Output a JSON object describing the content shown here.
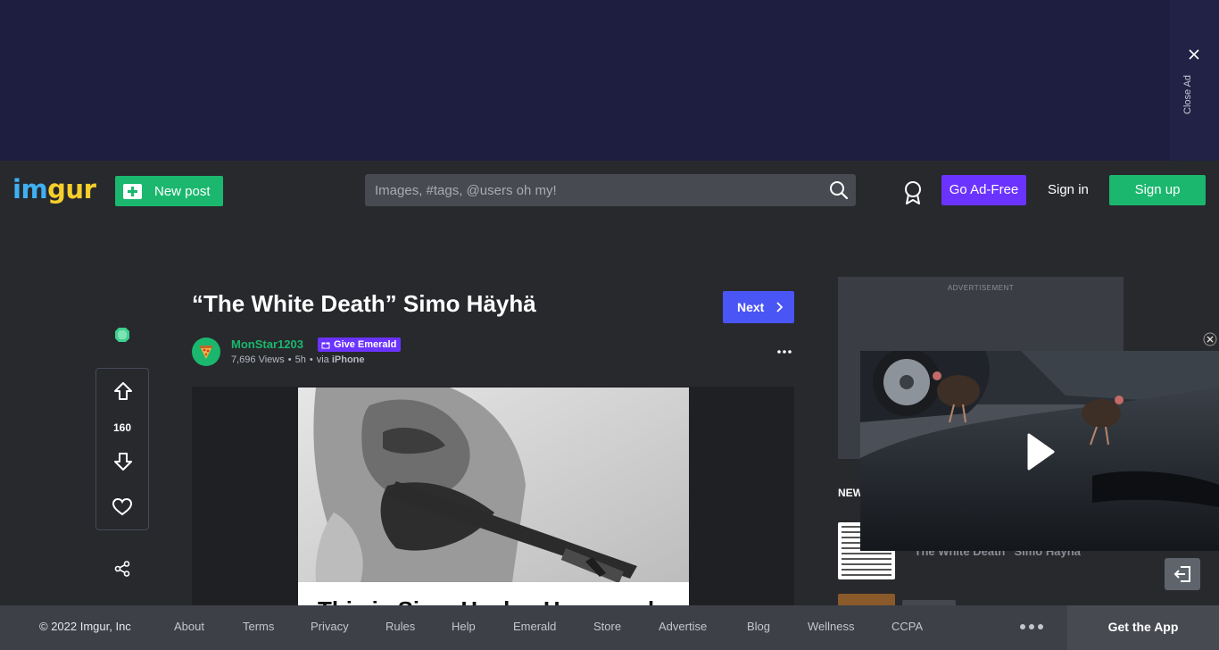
{
  "ad_banner": {
    "close_label": "Close Ad"
  },
  "header": {
    "logo_part1": "im",
    "logo_part2": "gur",
    "new_post_label": "New post",
    "search_placeholder": "Images, #tags, @users oh my!",
    "go_ad_free_label": "Go Ad-Free",
    "sign_in_label": "Sign in",
    "sign_up_label": "Sign up"
  },
  "post": {
    "title": "“The White Death” Simo Häyhä",
    "next_label": "Next",
    "username": "MonStar1203",
    "give_emerald_label": "Give Emerald",
    "views": "7,696 Views",
    "time_ago": "5h",
    "via_prefix": "via",
    "platform": "iPhone",
    "vote_count": "160",
    "caption_snippet": "This is Simo Hayha. He served"
  },
  "sidebar": {
    "ad_label": "ADVERTISEMENT",
    "new_section_label": "NEW",
    "related_title": "“The White Death” Simo Häyhä"
  },
  "footer": {
    "copyright": "© 2022 Imgur, Inc",
    "links": [
      "About",
      "Terms",
      "Privacy",
      "Rules",
      "Help",
      "Emerald",
      "Store",
      "Advertise",
      "Blog",
      "Wellness",
      "CCPA"
    ],
    "get_app_label": "Get the App"
  },
  "colors": {
    "accent_green": "#1bb76e",
    "emerald_purple": "#6b33ff",
    "next_blue": "#4a55f5",
    "ad_banner_bg": "#1d1e40"
  },
  "icons": [
    "close-icon",
    "plus-square-icon",
    "search-icon",
    "award-ribbon-icon",
    "emerald-gem-icon",
    "upvote-arrow-icon",
    "downvote-arrow-icon",
    "heart-icon",
    "share-icon",
    "chevron-right-icon",
    "more-dots-icon",
    "play-icon",
    "exit-icon"
  ]
}
